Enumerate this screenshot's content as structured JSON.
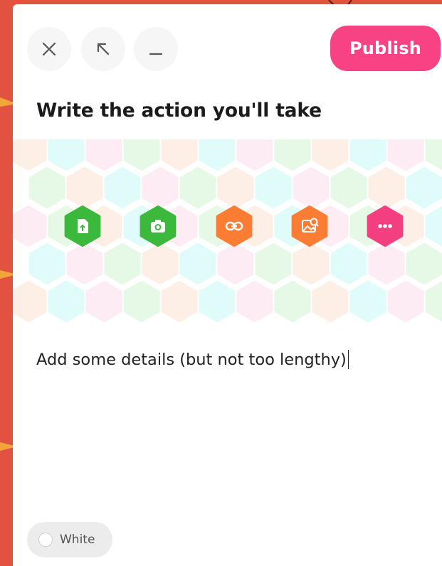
{
  "toolbar": {
    "close_icon": "close-icon",
    "expand_icon": "arrow-up-left-icon",
    "minimize_icon": "minimize-icon",
    "publish_label": "Publish"
  },
  "editor": {
    "title": "Write the action you'll take",
    "details_text": "Add some details (but not too lengthy)"
  },
  "attachments": [
    {
      "icon": "file-upload-icon",
      "color": "#3cb93c"
    },
    {
      "icon": "camera-icon",
      "color": "#3cb93c"
    },
    {
      "icon": "link-icon",
      "color": "#fb7d33"
    },
    {
      "icon": "image-search-icon",
      "color": "#fb7d33"
    },
    {
      "icon": "more-icon",
      "color": "#f33f80"
    }
  ],
  "card_color": {
    "label": "White"
  },
  "colors": {
    "background": "#e35141",
    "publish": "#f74383",
    "hex_pastels": [
      "#fdeee6",
      "#dffcfa",
      "#fdecf3",
      "#e6f9e6"
    ]
  }
}
